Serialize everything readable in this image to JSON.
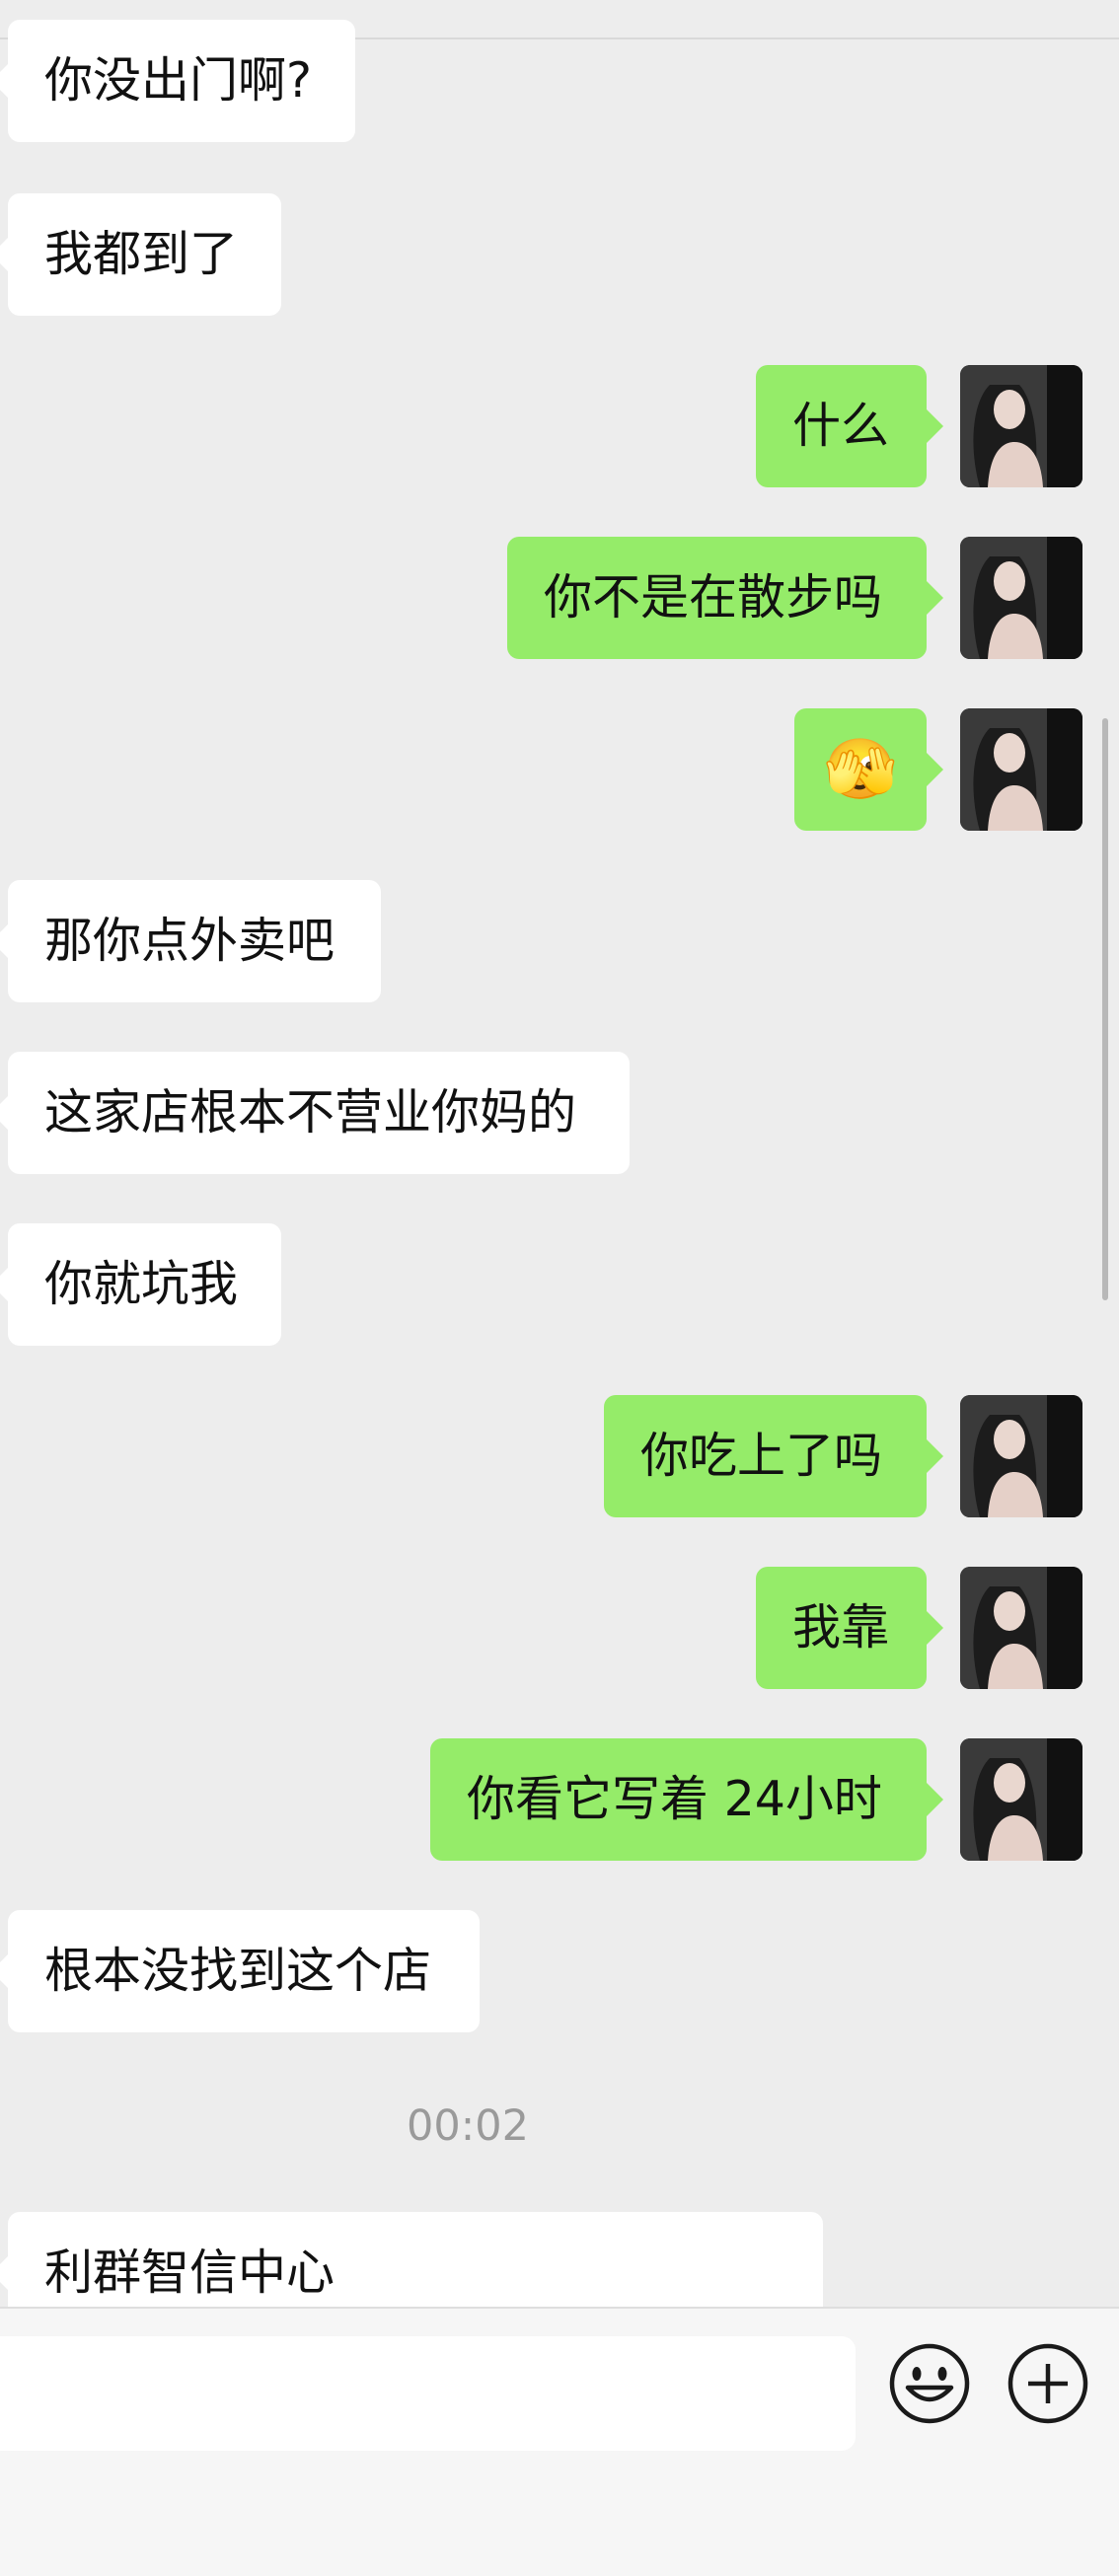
{
  "colors": {
    "background": "#ededed",
    "incoming_bubble": "#ffffff",
    "outgoing_bubble": "#95ec69",
    "timestamp_text": "#9a9a9a"
  },
  "messages": [
    {
      "side": "in",
      "text": "你没出门啊?"
    },
    {
      "side": "in",
      "text": "我都到了"
    },
    {
      "side": "out",
      "text": "什么"
    },
    {
      "side": "out",
      "text": "你不是在散步吗"
    },
    {
      "side": "out",
      "emoji": "🫣"
    },
    {
      "side": "in",
      "text": "那你点外卖吧"
    },
    {
      "side": "in",
      "text": "这家店根本不营业你妈的"
    },
    {
      "side": "in",
      "text": "你就坑我"
    },
    {
      "side": "out",
      "text": "你吃上了吗"
    },
    {
      "side": "out",
      "text": "我靠"
    },
    {
      "side": "out",
      "text": "你看它写着 24小时"
    },
    {
      "side": "in",
      "text": "根本没找到这个店"
    },
    {
      "side": "in",
      "text": "利群智信中心"
    }
  ],
  "timestamp": "00:02",
  "input_bar": {
    "text_value": "",
    "emoji_button_icon": "smiley-face-icon",
    "more_button_icon": "plus-circle-icon"
  }
}
